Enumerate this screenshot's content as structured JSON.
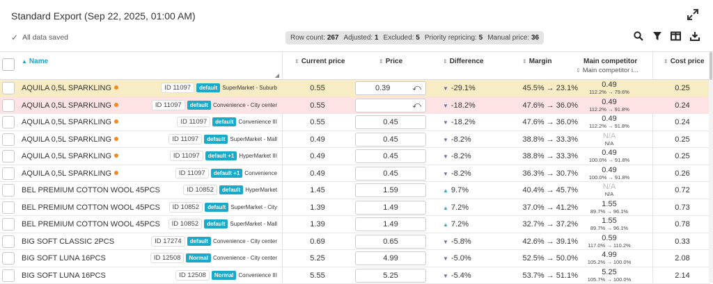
{
  "title": "Standard Export  (Sep 22, 2025, 01:00 AM)",
  "status": "All data saved",
  "stats": [
    {
      "label": "Row count:",
      "value": "267"
    },
    {
      "label": "Adjusted:",
      "value": "1"
    },
    {
      "label": "Excluded:",
      "value": "5"
    },
    {
      "label": "Priority repricing:",
      "value": "5"
    },
    {
      "label": "Manual price:",
      "value": "36"
    }
  ],
  "toolbar_icons": [
    "expand-icon",
    "search-icon",
    "filter-icon",
    "columns-icon",
    "download-icon"
  ],
  "columns": {
    "name": "Name",
    "current_price": "Current price",
    "price": "Price",
    "difference": "Difference",
    "margin": "Margin",
    "competitor": "Main competitor",
    "competitor_sub": "Main competitor i...",
    "cost": "Cost price"
  },
  "rows": [
    {
      "name": "AQUILA 0,5L SPARKLING",
      "dot": true,
      "id": "ID 11097",
      "badge": "default",
      "store": "SuperMarket - Suburb",
      "current": "0.55",
      "price": "0.39",
      "undo": true,
      "dir": "down",
      "diff": "-29.1%",
      "margin": "45.5% → 23.1%",
      "comp": "0.49",
      "comp_na": false,
      "comp_sub": "112.2% → 79.6%",
      "cost": "0.25",
      "style": "sel"
    },
    {
      "name": "AQUILA 0,5L SPARKLING",
      "dot": true,
      "id": "ID 11097",
      "badge": "default",
      "store": "Convenience - City center",
      "current": "0.55",
      "price": "",
      "undo": true,
      "dir": "down",
      "diff": "-18.2%",
      "margin": "47.6% → 36.0%",
      "comp": "0.49",
      "comp_na": false,
      "comp_sub": "112.2% → 91.8%",
      "cost": "0.24",
      "style": "pink"
    },
    {
      "name": "AQUILA 0,5L SPARKLING",
      "dot": true,
      "id": "ID 11097",
      "badge": "default",
      "store": "Convenience III",
      "current": "0.55",
      "price": "0.45",
      "undo": false,
      "dir": "down",
      "diff": "-18.2%",
      "margin": "47.6% → 36.0%",
      "comp": "0.49",
      "comp_na": false,
      "comp_sub": "112.2% → 91.8%",
      "cost": "0.24",
      "style": ""
    },
    {
      "name": "AQUILA 0,5L SPARKLING",
      "dot": true,
      "id": "ID 11097",
      "badge": "default",
      "store": "SuperMarket - Mall",
      "current": "0.49",
      "price": "0.45",
      "undo": false,
      "dir": "down",
      "diff": "-8.2%",
      "margin": "38.8% → 33.3%",
      "comp": "N/A",
      "comp_na": true,
      "comp_sub": "N/A",
      "cost": "0.25",
      "style": ""
    },
    {
      "name": "AQUILA 0,5L SPARKLING",
      "dot": true,
      "id": "ID 11097",
      "badge": "default +1",
      "store": "HyperMarket III",
      "current": "0.49",
      "price": "0.45",
      "undo": false,
      "dir": "down",
      "diff": "-8.2%",
      "margin": "38.8% → 33.3%",
      "comp": "0.49",
      "comp_na": false,
      "comp_sub": "100.0% → 91.8%",
      "cost": "0.25",
      "style": ""
    },
    {
      "name": "AQUILA 0,5L SPARKLING",
      "dot": true,
      "id": "ID 11097",
      "badge": "default +1",
      "store": "Convenience",
      "current": "0.49",
      "price": "0.45",
      "undo": false,
      "dir": "down",
      "diff": "-8.2%",
      "margin": "36.3% → 30.7%",
      "comp": "0.49",
      "comp_na": false,
      "comp_sub": "100.0% → 91.8%",
      "cost": "0.26",
      "style": ""
    },
    {
      "name": "BEL PREMIUM COTTON WOOL 45PCS",
      "dot": false,
      "id": "ID 10852",
      "badge": "default",
      "store": "HyperMarket",
      "current": "1.45",
      "price": "1.59",
      "undo": false,
      "dir": "up",
      "diff": "9.7%",
      "margin": "40.4% → 45.7%",
      "comp": "N/A",
      "comp_na": true,
      "comp_sub": "N/A",
      "cost": "0.72",
      "style": ""
    },
    {
      "name": "BEL PREMIUM COTTON WOOL 45PCS",
      "dot": false,
      "id": "ID 10852",
      "badge": "default",
      "store": "SuperMarket - City",
      "current": "1.39",
      "price": "1.49",
      "undo": false,
      "dir": "up",
      "diff": "7.2%",
      "margin": "37.0% → 41.2%",
      "comp": "1.55",
      "comp_na": false,
      "comp_sub": "89.7% → 96.1%",
      "cost": "0.73",
      "style": ""
    },
    {
      "name": "BEL PREMIUM COTTON WOOL 45PCS",
      "dot": false,
      "id": "ID 10852",
      "badge": "default",
      "store": "SuperMarket - Mall",
      "current": "1.39",
      "price": "1.49",
      "undo": false,
      "dir": "up",
      "diff": "7.2%",
      "margin": "32.7% → 37.2%",
      "comp": "1.55",
      "comp_na": false,
      "comp_sub": "89.7% → 96.1%",
      "cost": "0.78",
      "style": ""
    },
    {
      "name": "BIG SOFT CLASSIC 2PCS",
      "dot": false,
      "id": "ID 17274",
      "badge": "default",
      "store": "Convenience - City center",
      "current": "0.69",
      "price": "0.65",
      "undo": false,
      "dir": "down",
      "diff": "-5.8%",
      "margin": "42.6% → 39.1%",
      "comp": "0.59",
      "comp_na": false,
      "comp_sub": "117.0% → 110.2%",
      "cost": "0.33",
      "style": ""
    },
    {
      "name": "BIG SOFT LUNA 16PCS",
      "dot": false,
      "id": "ID 12508",
      "badge": "Normal",
      "store": "Convenience - City center",
      "current": "5.25",
      "price": "4.99",
      "undo": false,
      "dir": "down",
      "diff": "-5.0%",
      "margin": "52.5% → 50.0%",
      "comp": "4.99",
      "comp_na": false,
      "comp_sub": "105.2% → 100.0%",
      "cost": "2.08",
      "style": ""
    },
    {
      "name": "BIG SOFT LUNA 16PCS",
      "dot": false,
      "id": "ID 12508",
      "badge": "Normal",
      "store": "Convenience III",
      "current": "5.55",
      "price": "5.25",
      "undo": false,
      "dir": "down",
      "diff": "-5.4%",
      "margin": "53.7% → 51.1%",
      "comp": "5.25",
      "comp_na": false,
      "comp_sub": "105.7% → 100.0%",
      "cost": "2.14",
      "style": ""
    }
  ]
}
